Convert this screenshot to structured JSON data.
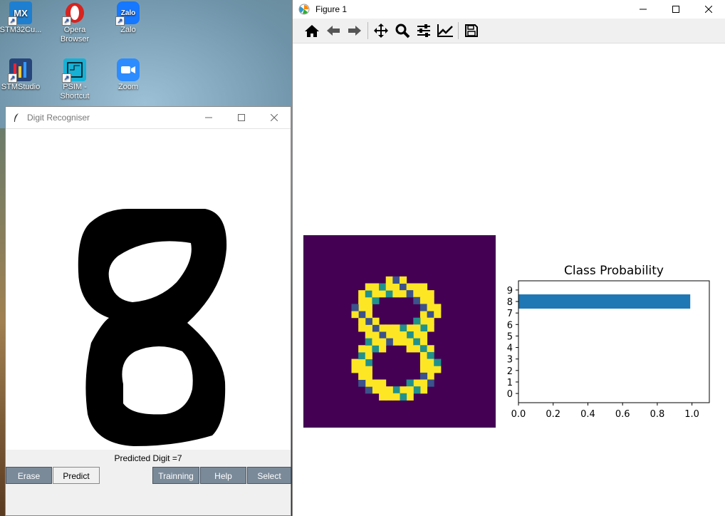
{
  "desktop": {
    "icons": [
      {
        "label": "STM32Cu...",
        "glyph": "MX",
        "color": "#1e7fd0",
        "icon": "stm32cubemx-icon"
      },
      {
        "label": "Opera Browser",
        "glyph": "O",
        "color": "#d8231f",
        "icon": "opera-icon"
      },
      {
        "label": "Zalo",
        "glyph": "Zalo",
        "color": "#1677ff",
        "icon": "zalo-icon"
      },
      {
        "label": "STMStudio",
        "glyph": "",
        "color": "#27457a",
        "icon": "stmstudio-icon"
      },
      {
        "label": "PSIM - Shortcut",
        "glyph": "",
        "color": "#17b1d6",
        "icon": "psim-icon"
      },
      {
        "label": "Zoom",
        "glyph": "",
        "color": "#2d8cff",
        "icon": "zoom-icon"
      }
    ]
  },
  "digit_window": {
    "title": "Digit Recogniser",
    "predicted_text": "Predicted Digit =7",
    "buttons": {
      "erase": "Erase",
      "predict": "Predict",
      "training": "Trainning",
      "help": "Help",
      "select": "Select"
    }
  },
  "figure_window": {
    "title": "Figure 1",
    "toolbar": [
      "home-icon",
      "back-icon",
      "forward-icon",
      "pan-icon",
      "zoom-icon",
      "configure-subplots-icon",
      "edit-axis-icon",
      "save-icon"
    ]
  },
  "chart_data": {
    "type": "bar",
    "orientation": "horizontal",
    "title": "Class Probability",
    "categories": [
      "0",
      "1",
      "2",
      "3",
      "4",
      "5",
      "6",
      "7",
      "8",
      "9"
    ],
    "values": [
      0,
      0,
      0,
      0,
      0,
      0,
      0,
      0,
      0.99,
      0
    ],
    "xlim": [
      0,
      1.1
    ],
    "xticks": [
      "0.0",
      "0.2",
      "0.4",
      "0.6",
      "0.8",
      "1.0"
    ],
    "color": "#1f77b4"
  },
  "colors": {
    "viridis_bg": "#440154",
    "viridis_hi": "#fde725",
    "viridis_mid": "#21918c",
    "viridis_lo": "#3b528b"
  }
}
